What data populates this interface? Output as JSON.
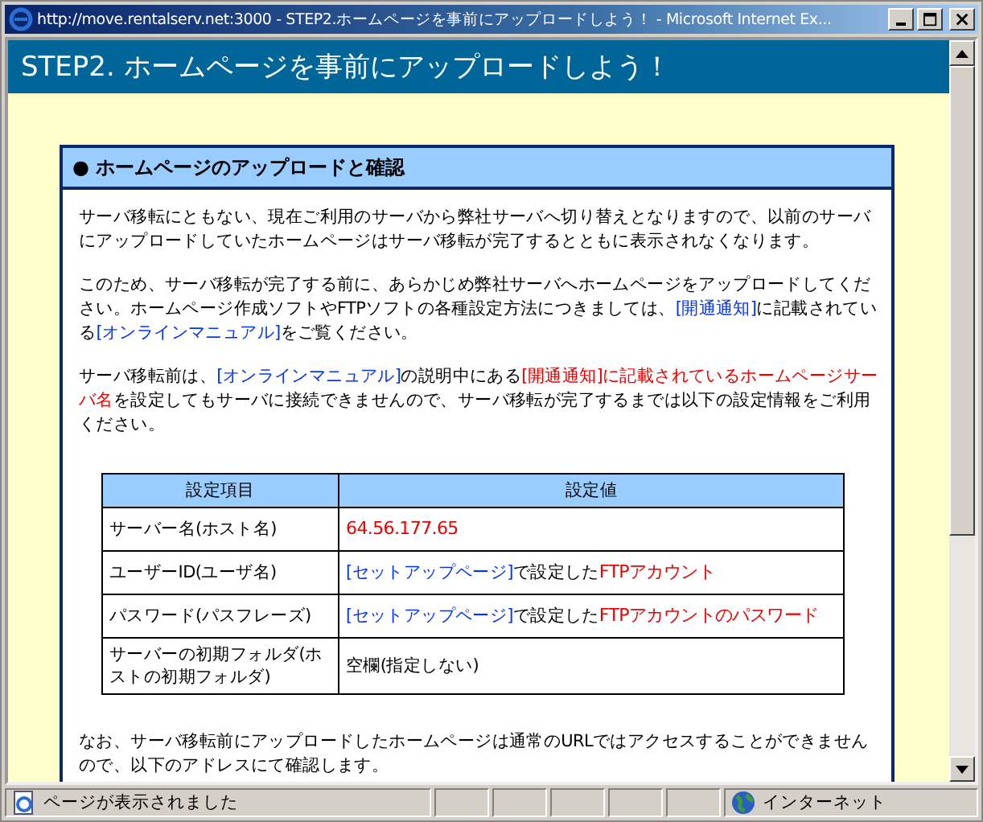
{
  "window": {
    "title": "http://move.rentalserv.net:3000 - STEP2.ホームページを事前にアップロードしよう！ - Microsoft Internet Ex..."
  },
  "page_title": "STEP2. ホームページを事前にアップロードしよう！",
  "section": {
    "bullet": "●",
    "heading": "ホームページのアップロードと確認",
    "paragraphs": [
      [
        {
          "kind": "text",
          "text": "サーバ移転にともない、現在ご利用のサーバから弊社サーバへ切り替えとなりますので、以前のサーバにアップロードしていたホームページはサーバ移転が完了するとともに表示されなくなります。"
        }
      ],
      [
        {
          "kind": "text",
          "text": "このため、サーバ移転が完了する前に、あらかじめ弊社サーバへホームページをアップロードしてください。ホームページ作成ソフトやFTPソフトの各種設定方法につきましては、"
        },
        {
          "kind": "link",
          "text": "[開通通知]"
        },
        {
          "kind": "text",
          "text": "に記載されている"
        },
        {
          "kind": "link",
          "text": "[オンラインマニュアル]"
        },
        {
          "kind": "text",
          "text": "をご覧ください。"
        }
      ],
      [
        {
          "kind": "text",
          "text": "サーバ移転前は、"
        },
        {
          "kind": "link",
          "text": "[オンラインマニュアル]"
        },
        {
          "kind": "text",
          "text": "の説明中にある"
        },
        {
          "kind": "emph",
          "text": "[開通通知]に記載されているホームページサーバ名"
        },
        {
          "kind": "text",
          "text": "を設定してもサーバに接続できませんので、サーバ移転が完了するまでは以下の設定情報をご利用ください。"
        }
      ]
    ],
    "table": {
      "columns": [
        "設定項目",
        "設定値"
      ],
      "rows": [
        {
          "item": "サーバー名(ホスト名)",
          "value": [
            {
              "kind": "emph",
              "text": "64.56.177.65"
            }
          ]
        },
        {
          "item": "ユーザーID(ユーザ名)",
          "value": [
            {
              "kind": "link",
              "text": "[セットアップページ]"
            },
            {
              "kind": "text",
              "text": "で設定した"
            },
            {
              "kind": "emph",
              "text": "FTPアカウント"
            }
          ]
        },
        {
          "item": "パスワード(パスフレーズ)",
          "value": [
            {
              "kind": "link",
              "text": "[セットアップページ]"
            },
            {
              "kind": "text",
              "text": "で設定した"
            },
            {
              "kind": "emph",
              "text": "FTPアカウントのパスワード"
            }
          ]
        },
        {
          "item": "サーバーの初期フォルダ(ホストの初期フォルダ)",
          "value": [
            {
              "kind": "text",
              "text": "空欄(指定しない)"
            }
          ]
        }
      ]
    },
    "footer_paragraph": "なお、サーバ移転前にアップロードしたホームページは通常のURLではアクセスすることができませんので、以下のアドレスにて確認します。"
  },
  "status_bar": {
    "message": "ページが表示されました",
    "zone": "インターネット"
  }
}
